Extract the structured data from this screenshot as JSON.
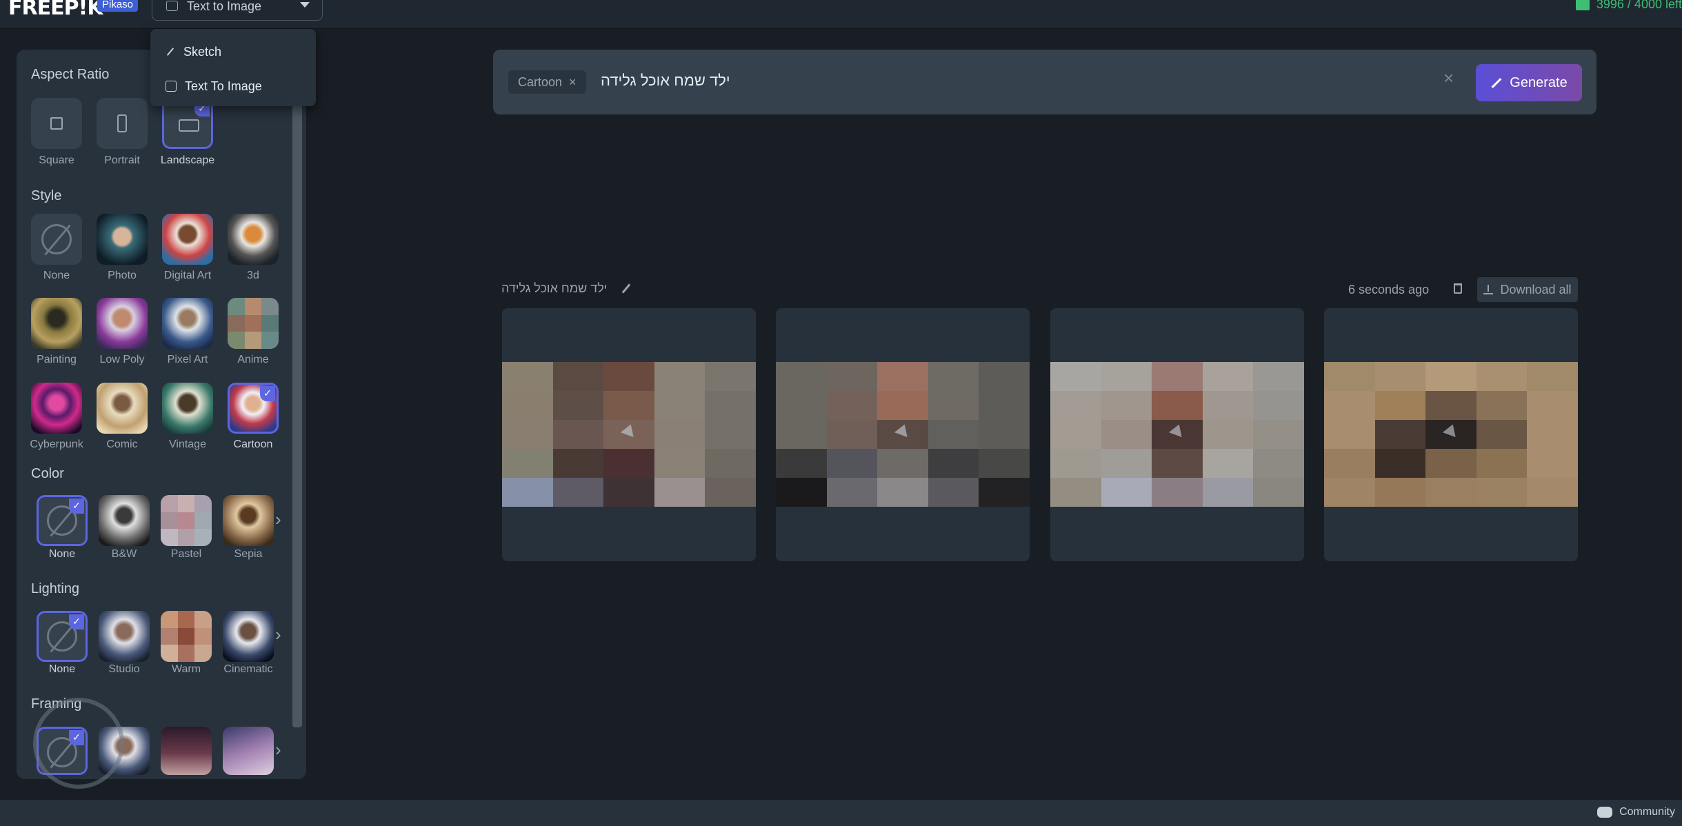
{
  "header": {
    "logo": "FREEP!K",
    "badge": "Pikaso",
    "mode_selected": "Text to Image",
    "credits": "3996 / 4000 left"
  },
  "mode_menu": {
    "items": [
      {
        "label": "Sketch",
        "icon": "pencil-icon"
      },
      {
        "label": "Text To Image",
        "icon": "image-icon"
      }
    ]
  },
  "panel": {
    "aspect_ratio": {
      "title": "Aspect Ratio",
      "options": [
        {
          "label": "Square",
          "selected": false
        },
        {
          "label": "Portrait",
          "selected": false
        },
        {
          "label": "Landscape",
          "selected": true
        }
      ]
    },
    "style": {
      "title": "Style",
      "options": [
        {
          "label": "None",
          "selected": false
        },
        {
          "label": "Photo",
          "selected": false
        },
        {
          "label": "Digital Art",
          "selected": false
        },
        {
          "label": "3d",
          "selected": false
        },
        {
          "label": "Painting",
          "selected": false
        },
        {
          "label": "Low Poly",
          "selected": false
        },
        {
          "label": "Pixel Art",
          "selected": false
        },
        {
          "label": "Anime",
          "selected": false
        },
        {
          "label": "Cyberpunk",
          "selected": false
        },
        {
          "label": "Comic",
          "selected": false
        },
        {
          "label": "Vintage",
          "selected": false
        },
        {
          "label": "Cartoon",
          "selected": true
        }
      ]
    },
    "color": {
      "title": "Color",
      "options": [
        {
          "label": "None",
          "selected": true
        },
        {
          "label": "B&W",
          "selected": false
        },
        {
          "label": "Pastel",
          "selected": false
        },
        {
          "label": "Sepia",
          "selected": false
        }
      ]
    },
    "lighting": {
      "title": "Lighting",
      "options": [
        {
          "label": "None",
          "selected": true
        },
        {
          "label": "Studio",
          "selected": false
        },
        {
          "label": "Warm",
          "selected": false
        },
        {
          "label": "Cinematic",
          "selected": false
        }
      ]
    },
    "framing": {
      "title": "Framing"
    }
  },
  "prompt": {
    "chip": "Cartoon",
    "text": "ילד שמח אוכל גלידה",
    "generate_label": "Generate"
  },
  "results": {
    "title": "ילד שמח אוכל גלידה",
    "time": "6 seconds ago",
    "download_label": "Download all"
  },
  "footer": {
    "community": "Community"
  },
  "colors": {
    "accent": "#5b66e0",
    "credits": "#3fbf74",
    "background": "#181e24",
    "panel": "#28323d"
  }
}
